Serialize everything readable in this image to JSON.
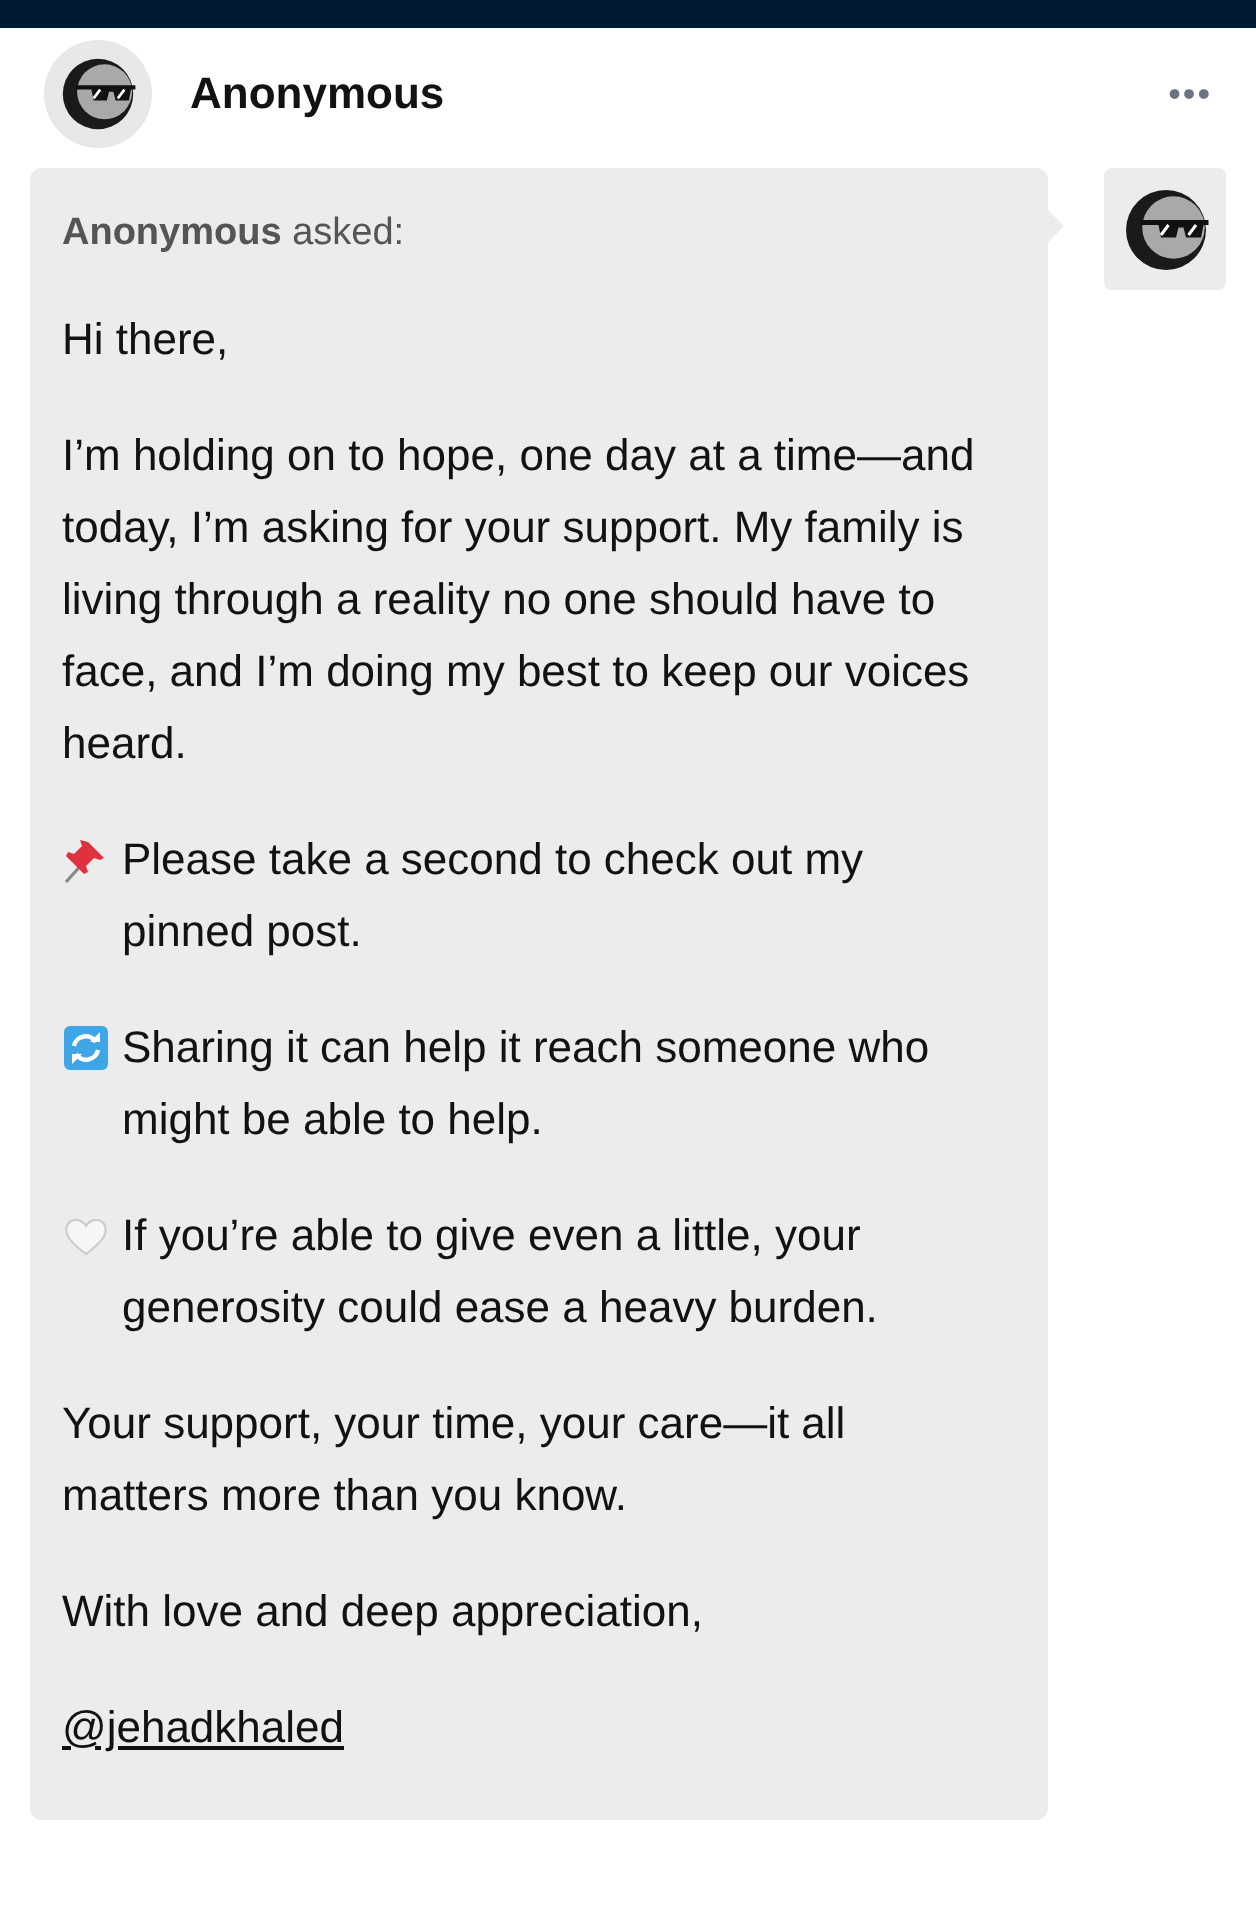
{
  "header": {
    "name": "Anonymous",
    "menu": "•••"
  },
  "ask": {
    "asker": "Anonymous",
    "verb": "asked:",
    "paragraphs": [
      {
        "kind": "text",
        "text": "Hi there,"
      },
      {
        "kind": "text",
        "text": "I’m holding on to hope, one day at a time—and today, I’m asking for your support. My family is living through a reality no one should have to face, and I’m doing my best to keep our voices heard."
      },
      {
        "kind": "pin",
        "text": "Please take a second to check out my pinned post."
      },
      {
        "kind": "repost",
        "text": "Sharing it can help it reach someone who might be able to help."
      },
      {
        "kind": "heart",
        "text": "If you’re able to give even a little, your generosity could ease a heavy burden."
      },
      {
        "kind": "text",
        "text": "Your support, your time, your care—it all matters more than you know."
      },
      {
        "kind": "text",
        "text": "With love and deep appreciation,"
      },
      {
        "kind": "link",
        "text": "@jehadkhaled"
      }
    ]
  }
}
